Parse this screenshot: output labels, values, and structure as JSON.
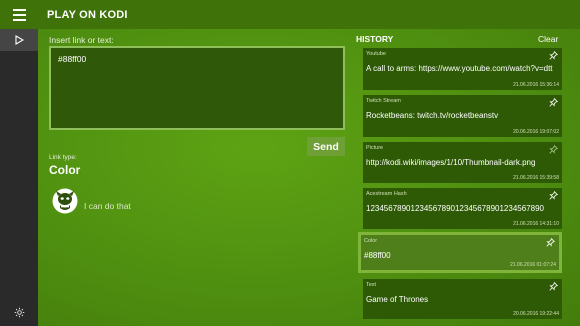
{
  "app": {
    "title": "PLAY ON KODI"
  },
  "input": {
    "label": "Insert link or text:",
    "value": "#88ff00",
    "send_label": "Send"
  },
  "link_type": {
    "label": "Link type:",
    "value": "Color",
    "message": "I can do that"
  },
  "history": {
    "title": "HISTORY",
    "clear_label": "Clear",
    "items": [
      {
        "category": "Youtube",
        "text": "A call to arms: https://www.youtube.com/watch?v=dtt",
        "date": "21.06.2016 15:36:14",
        "pinned": true,
        "selected": false
      },
      {
        "category": "Twitch Stream",
        "text": "Rocketbeans: twitch.tv/rocketbeanstv",
        "date": "20.06.2016 19:07:02",
        "pinned": true,
        "selected": false
      },
      {
        "category": "Picture",
        "text": "http://kodi.wiki/images/1/10/Thumbnail-dark.png",
        "date": "21.06.2016 15:39:58",
        "pinned": false,
        "selected": false
      },
      {
        "category": "Acestream Hash",
        "text": "1234567890123456789012345678901234567890",
        "date": "21.06.2016 14:31:10",
        "pinned": true,
        "selected": false
      },
      {
        "category": "Color",
        "text": "#88ff00",
        "date": "21.06.2016 01:07:24",
        "pinned": true,
        "selected": true
      },
      {
        "category": "Text",
        "text": "Game of Thrones",
        "date": "20.06.2016 19:22:44",
        "pinned": true,
        "selected": false
      }
    ]
  },
  "colors": {
    "accent": "#88ff00",
    "background": "#4f8a10",
    "card": "#2e5a06",
    "rail": "#2a2a2a"
  },
  "icons": {
    "menu": "hamburger-icon",
    "play": "play-icon",
    "settings": "gear-icon",
    "pin": "pin-icon",
    "kodi": "kodi-mascot-icon"
  }
}
